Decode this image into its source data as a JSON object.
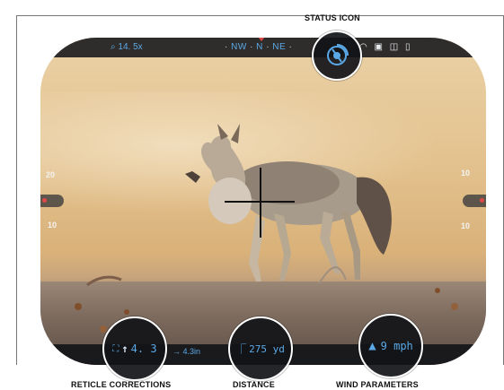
{
  "labels": {
    "status_icon": "STATUS ICON",
    "reticle_corrections": "RETICLE CORRECTIONS",
    "distance": "DISTANCE",
    "wind_parameters": "WIND PARAMETERS"
  },
  "hud": {
    "zoom": "14. 5x",
    "compass": {
      "west": "NW",
      "center": "N",
      "east": "NE"
    },
    "status_glyphs": {
      "wifi": "wifi-icon",
      "sd": "sd-card-icon",
      "camera": "camera-icon",
      "battery": "battery-icon"
    },
    "left_scale": {
      "top": "20",
      "mid": "10"
    },
    "right_scale": {
      "top": "10",
      "bottom": "10"
    },
    "reticle_correction": "4. 3",
    "reticle_offset": "→ 4.3in",
    "distance": "275 yd",
    "wind_speed": "9 mph"
  },
  "colors": {
    "accent": "#5aa9e6",
    "marker": "#e04848",
    "bar": "#15171b"
  }
}
